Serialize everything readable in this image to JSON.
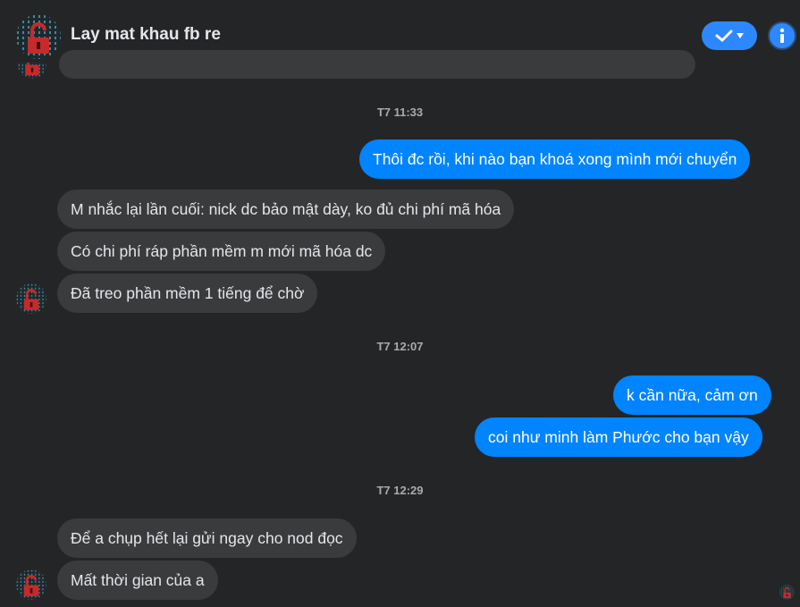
{
  "header": {
    "title": "Lay mat khau fb re"
  },
  "timestamps": [
    "T7 11:33",
    "T7 12:07",
    "T7 12:29"
  ],
  "messages": [
    {
      "text": "Thôi đc rồi, khi nào bạn khoá xong mình mới chuyển",
      "from": "me"
    },
    {
      "text": "M nhắc lại lần cuối: nick dc bảo mật dày, ko đủ chi phí mã hóa",
      "from": "them"
    },
    {
      "text": "Có chi phí ráp phần mềm m mới mã hóa dc",
      "from": "them"
    },
    {
      "text": "Đã treo phần mềm 1 tiếng để chờ",
      "from": "them"
    },
    {
      "text": "k cần nữa, cảm ơn",
      "from": "me"
    },
    {
      "text": "coi như minh làm Phước cho bạn vậy",
      "from": "me"
    },
    {
      "text": "Để a chụp hết lại gửi ngay cho nod đọc",
      "from": "them"
    },
    {
      "text": "Mất thời gian của a",
      "from": "them"
    }
  ],
  "colors": {
    "background": "#242526",
    "incoming": "#3a3b3c",
    "outgoing": "#0084ff",
    "accent": "#2d88ff"
  },
  "icons": {
    "check": "checkmark-icon",
    "dropdown": "caret-down-icon",
    "info": "info-icon"
  }
}
